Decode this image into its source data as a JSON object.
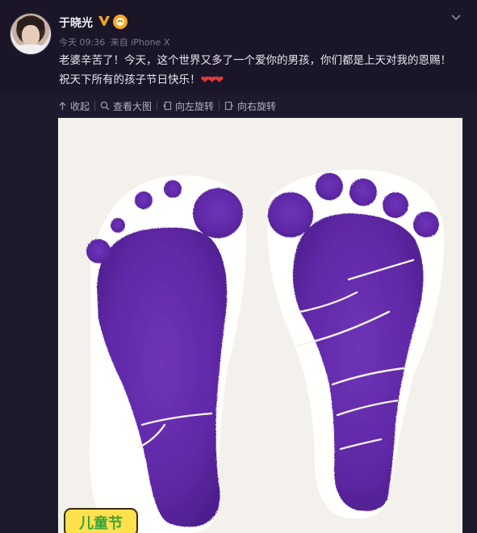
{
  "user": {
    "name": "于晓光"
  },
  "meta": {
    "time": "今天 09:36",
    "source": "来自 iPhone X"
  },
  "post": {
    "text": "老婆辛苦了！今天，这个世界又多了一个爱你的男孩，你们都是上天对我的恩赐！祝天下所有的孩子节日快乐！",
    "hearts": "❤❤❤"
  },
  "actions": {
    "collapse": "收起",
    "view_large": "查看大图",
    "rotate_left": "向左旋转",
    "rotate_right": "向右旋转"
  },
  "sticker": {
    "text": "儿童节"
  },
  "colors": {
    "ink": "#6a2fb0",
    "paper": "#f4f1ec",
    "background": "#1e1a2e",
    "heart": "#e33b3b",
    "verified": "#f6a623"
  },
  "icons": [
    "chevron-down-icon",
    "verified-v-icon",
    "member-icon",
    "collapse-icon",
    "zoom-icon",
    "rotate-left-icon",
    "rotate-right-icon"
  ]
}
